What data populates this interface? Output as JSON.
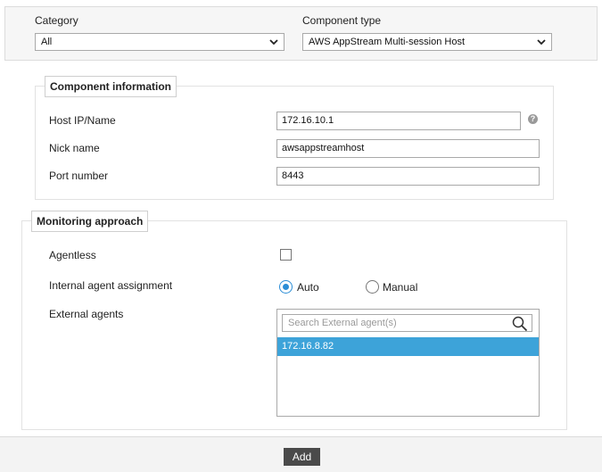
{
  "top": {
    "category_label": "Category",
    "category_value": "All",
    "component_type_label": "Component type",
    "component_type_value": "AWS AppStream Multi-session Host"
  },
  "component_info": {
    "legend": "Component information",
    "host_label": "Host IP/Name",
    "host_value": "172.16.10.1",
    "nick_label": "Nick name",
    "nick_value": "awsappstreamhost",
    "port_label": "Port number",
    "port_value": "8443",
    "help_icon": "question-circle-icon"
  },
  "monitoring": {
    "legend": "Monitoring approach",
    "agentless_label": "Agentless",
    "agentless_checked": false,
    "assignment_label": "Internal agent assignment",
    "auto_label": "Auto",
    "manual_label": "Manual",
    "selected_assignment": "Auto",
    "external_label": "External agents",
    "search_placeholder": "Search External agent(s)",
    "agents": [
      "172.16.8.82"
    ],
    "search_icon": "search-icon"
  },
  "footer": {
    "add_label": "Add"
  },
  "colors": {
    "accent": "#3da3d9",
    "radio_selected": "#2b8dd6",
    "button_bg": "#4a4a4a"
  }
}
